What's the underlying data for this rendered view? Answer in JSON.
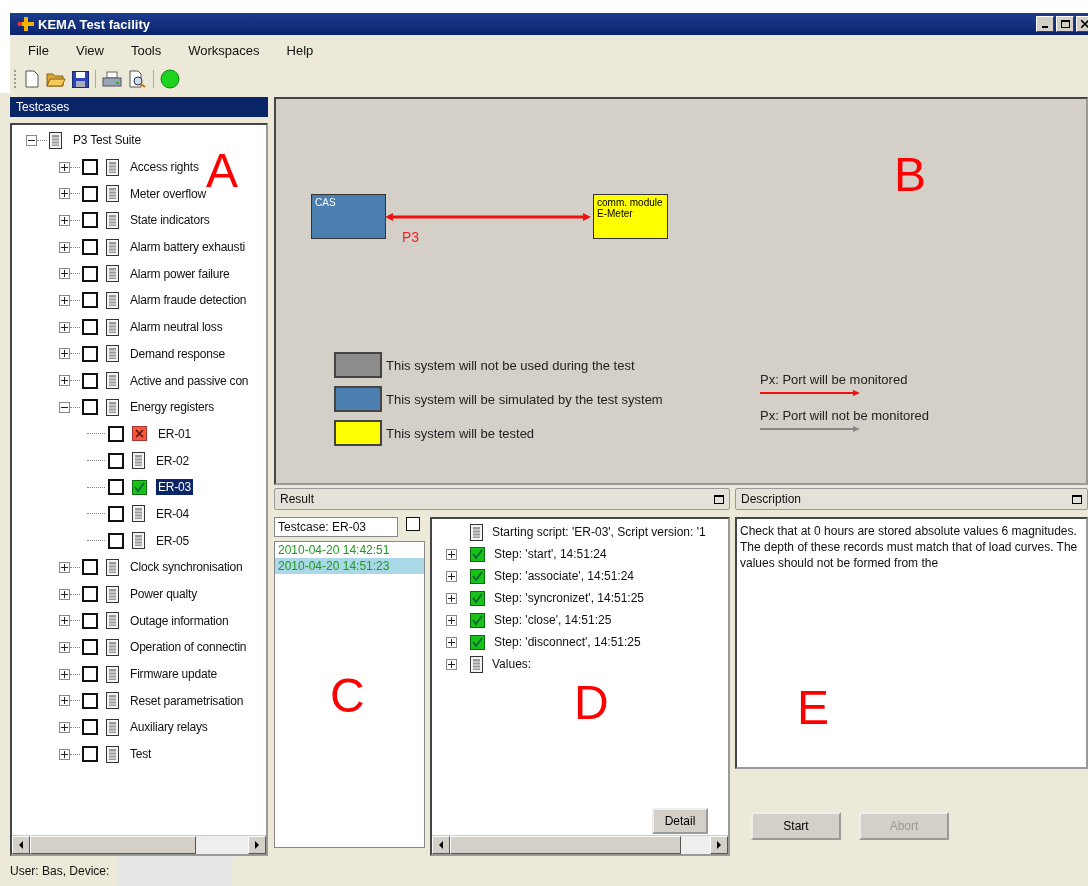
{
  "window": {
    "title": "KEMA Test facility"
  },
  "menu": [
    {
      "label": "File"
    },
    {
      "label": "View"
    },
    {
      "label": "Tools"
    },
    {
      "label": "Workspaces"
    },
    {
      "label": "Help"
    }
  ],
  "testcases": {
    "title": "Testcases",
    "annotation": "A",
    "tree": [
      {
        "label": "P3 Test Suite",
        "expanded": true,
        "selected": false,
        "children": [
          {
            "label": "Access rights",
            "expanded": false,
            "checked": false,
            "selected": false
          },
          {
            "label": "Meter overflow",
            "expanded": false,
            "checked": false,
            "selected": false
          },
          {
            "label": "State indicators",
            "expanded": false,
            "checked": false,
            "selected": false
          },
          {
            "label": "Alarm battery exhausti",
            "expanded": false,
            "checked": false,
            "selected": false
          },
          {
            "label": "Alarm power failure",
            "expanded": false,
            "checked": false,
            "selected": false
          },
          {
            "label": "Alarm fraude detection",
            "expanded": false,
            "checked": false,
            "selected": false
          },
          {
            "label": "Alarm neutral loss",
            "expanded": false,
            "checked": false,
            "selected": false
          },
          {
            "label": "Demand response",
            "expanded": false,
            "checked": false,
            "selected": false
          },
          {
            "label": "Active and passive con",
            "expanded": false,
            "checked": false,
            "selected": false
          },
          {
            "label": "Energy registers",
            "expanded": true,
            "checked": false,
            "selected": false,
            "children": [
              {
                "label": "ER-01",
                "checked": false,
                "selected": false,
                "failed": true,
                "passed": false
              },
              {
                "label": "ER-02",
                "checked": false,
                "selected": false,
                "failed": false,
                "passed": false
              },
              {
                "label": "ER-03",
                "checked": false,
                "selected": true,
                "failed": false,
                "passed": true
              },
              {
                "label": "ER-04",
                "checked": false,
                "selected": false,
                "failed": false,
                "passed": false
              },
              {
                "label": "ER-05",
                "checked": false,
                "selected": false,
                "failed": false,
                "passed": false
              }
            ]
          },
          {
            "label": "Clock synchronisation",
            "expanded": false,
            "checked": false,
            "selected": false
          },
          {
            "label": "Power qualty",
            "expanded": false,
            "checked": false,
            "selected": false
          },
          {
            "label": "Outage information",
            "expanded": false,
            "checked": false,
            "selected": false
          },
          {
            "label": "Operation of connectin",
            "expanded": false,
            "checked": false,
            "selected": false
          },
          {
            "label": "Firmware update",
            "expanded": false,
            "checked": false,
            "selected": false
          },
          {
            "label": "Reset parametrisation",
            "expanded": false,
            "checked": false,
            "selected": false
          },
          {
            "label": "Auxiliary relays",
            "expanded": false,
            "checked": false,
            "selected": false
          },
          {
            "label": "Test",
            "expanded": false,
            "checked": false,
            "selected": false
          }
        ]
      }
    ]
  },
  "diagram": {
    "annotation": "B",
    "nodes": [
      {
        "label": "CAS",
        "color": "#4a7fb0"
      },
      {
        "label": "comm. module E-Meter",
        "color": "#ffff00"
      }
    ],
    "link": {
      "label": "P3",
      "monitored": true
    },
    "legend": [
      {
        "text": "This system will not be used during the test",
        "color": "#8c8c8c"
      },
      {
        "text": "This system will be simulated by the test system",
        "color": "#4a7fb0"
      },
      {
        "text": "This system will be tested",
        "color": "#ffff00"
      }
    ],
    "port_legend": [
      {
        "text": "Px: Port will be monitored",
        "monitored": true
      },
      {
        "text": "Px: Port will not be monitored",
        "monitored": false
      }
    ]
  },
  "result": {
    "title": "Result",
    "annotation_runs": "C",
    "annotation_log": "D",
    "testcase": "Testcase: ER-03",
    "filter_checked": false,
    "runs": [
      {
        "text": "2010-04-20 14:42:51",
        "passed": true,
        "selected": false
      },
      {
        "text": "2010-04-20 14:51:23",
        "passed": true,
        "selected": true
      }
    ],
    "log": [
      {
        "text": "Starting script: 'ER-03', Script version: '1",
        "expandable": false,
        "passed": false
      },
      {
        "text": "Step: 'start', 14:51:24",
        "expandable": true,
        "passed": true
      },
      {
        "text": "Step: 'associate', 14:51:24",
        "expandable": true,
        "passed": true
      },
      {
        "text": "Step: 'syncronizet', 14:51:25",
        "expandable": true,
        "passed": true
      },
      {
        "text": "Step: 'close', 14:51:25",
        "expandable": true,
        "passed": true
      },
      {
        "text": "Step: 'disconnect', 14:51:25",
        "expandable": true,
        "passed": true
      },
      {
        "text": "Values:",
        "expandable": true,
        "passed": false
      }
    ],
    "detail_button": "Detail"
  },
  "description": {
    "title": "Description",
    "annotation": "E",
    "text": "Check that at 0 hours are stored absolute values 6 magnitudes. The depth of these records must match that of load curves. The values should not be formed from the",
    "buttons": [
      {
        "label": "Start",
        "disabled": false
      },
      {
        "label": "Abort",
        "disabled": true
      }
    ]
  },
  "status_bar": {
    "text": "User: Bas, Device:"
  }
}
